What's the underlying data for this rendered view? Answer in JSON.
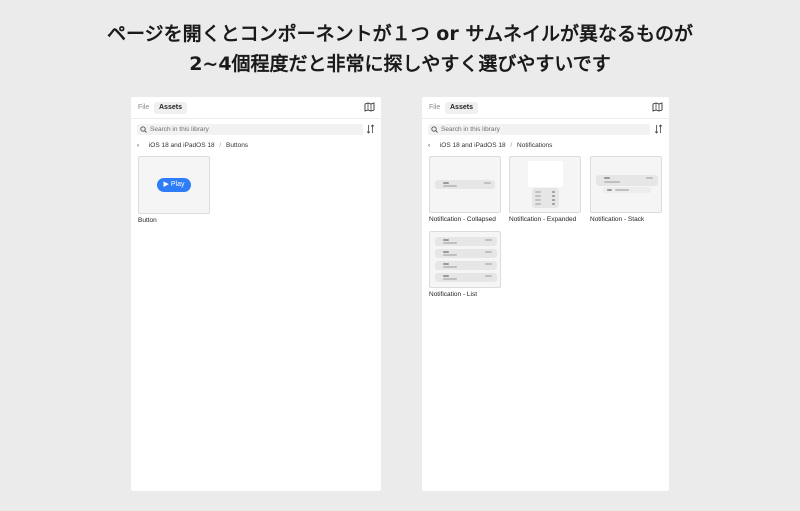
{
  "heading": {
    "line1": "ページを開くとコンポーネントが１つ or サムネイルが異なるものが",
    "line2": "2~4個程度だと非常に探しやすく選びやすいです"
  },
  "left_panel": {
    "tab_file": "File",
    "tab_assets": "Assets",
    "search_placeholder": "Search in this library",
    "breadcrumb": {
      "root": "iOS 18 and iPadOS 18",
      "separator": "/",
      "current": "Buttons"
    },
    "components": [
      {
        "label": "Button",
        "play_label": "▶ Play"
      }
    ]
  },
  "right_panel": {
    "tab_file": "File",
    "tab_assets": "Assets",
    "search_placeholder": "Search in this library",
    "breadcrumb": {
      "root": "iOS 18 and iPadOS 18",
      "separator": "/",
      "current": "Notifications"
    },
    "components": [
      {
        "label": "Notification - Collapsed"
      },
      {
        "label": "Notification - Expanded"
      },
      {
        "label": "Notification - Stack"
      },
      {
        "label": "Notification - List"
      }
    ]
  },
  "colors": {
    "background": "#ebebeb",
    "panel": "#ffffff",
    "accent": "#2f7df6"
  },
  "icons": [
    "library-icon",
    "search-icon",
    "sort-icon",
    "back-chevron-icon"
  ]
}
